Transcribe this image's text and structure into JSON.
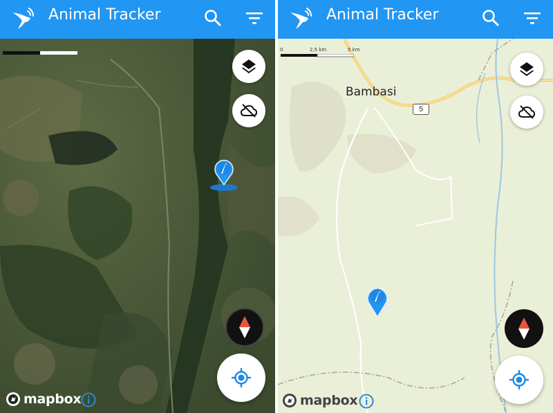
{
  "left_screen": {
    "app_title": "Animal Tracker",
    "map_style": "satellite",
    "attribution": {
      "brand": "mapbox"
    }
  },
  "right_screen": {
    "app_title": "Animal Tracker",
    "map_style": "streets",
    "place_label": "Bambasi",
    "road_shield": "5",
    "scale": {
      "zero": "0",
      "mid": "2,5 km",
      "end": "5 km"
    },
    "attribution": {
      "brand": "mapbox"
    }
  },
  "icons": [
    "bird-logo-icon",
    "search-icon",
    "filter-icon",
    "layers-icon",
    "cloud-off-icon",
    "compass-icon",
    "my-location-icon",
    "bird-marker-icon",
    "mapbox-logo-icon",
    "info-icon"
  ],
  "colors": {
    "appbar": "#2196f3",
    "marker": "#2196f3",
    "compass_north": "#e8553f"
  }
}
